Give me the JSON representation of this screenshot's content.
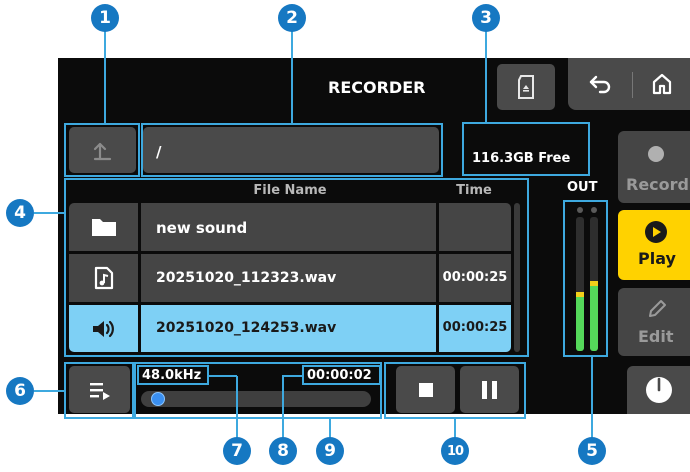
{
  "header": {
    "title": "RECORDER"
  },
  "path": {
    "current": "/"
  },
  "storage": {
    "free": "116.3GB Free"
  },
  "table": {
    "col_name": "File Name",
    "col_time": "Time",
    "rows": [
      {
        "icon": "folder-icon",
        "name": "new sound",
        "time": ""
      },
      {
        "icon": "music-file-icon",
        "name": "20251020_112323.wav",
        "time": "00:00:25"
      },
      {
        "icon": "speaker-icon",
        "name": "20251020_124253.wav",
        "time": "00:00:25",
        "selected": true
      }
    ]
  },
  "meter": {
    "label": "OUT",
    "left_level": 0.44,
    "right_level": 0.52
  },
  "side": {
    "record": "Record",
    "play": "Play",
    "edit": "Edit"
  },
  "transport": {
    "sample_rate": "48.0kHz",
    "elapsed": "00:00:02",
    "progress": 0.04
  },
  "callouts": [
    "1",
    "2",
    "3",
    "4",
    "5",
    "6",
    "7",
    "8",
    "9",
    "10"
  ],
  "colors": {
    "accent": "#3ea9df",
    "callout": "#1678c2",
    "selected_row": "#7ed0f5",
    "play": "#ffd200",
    "meter": "#55d85a"
  }
}
